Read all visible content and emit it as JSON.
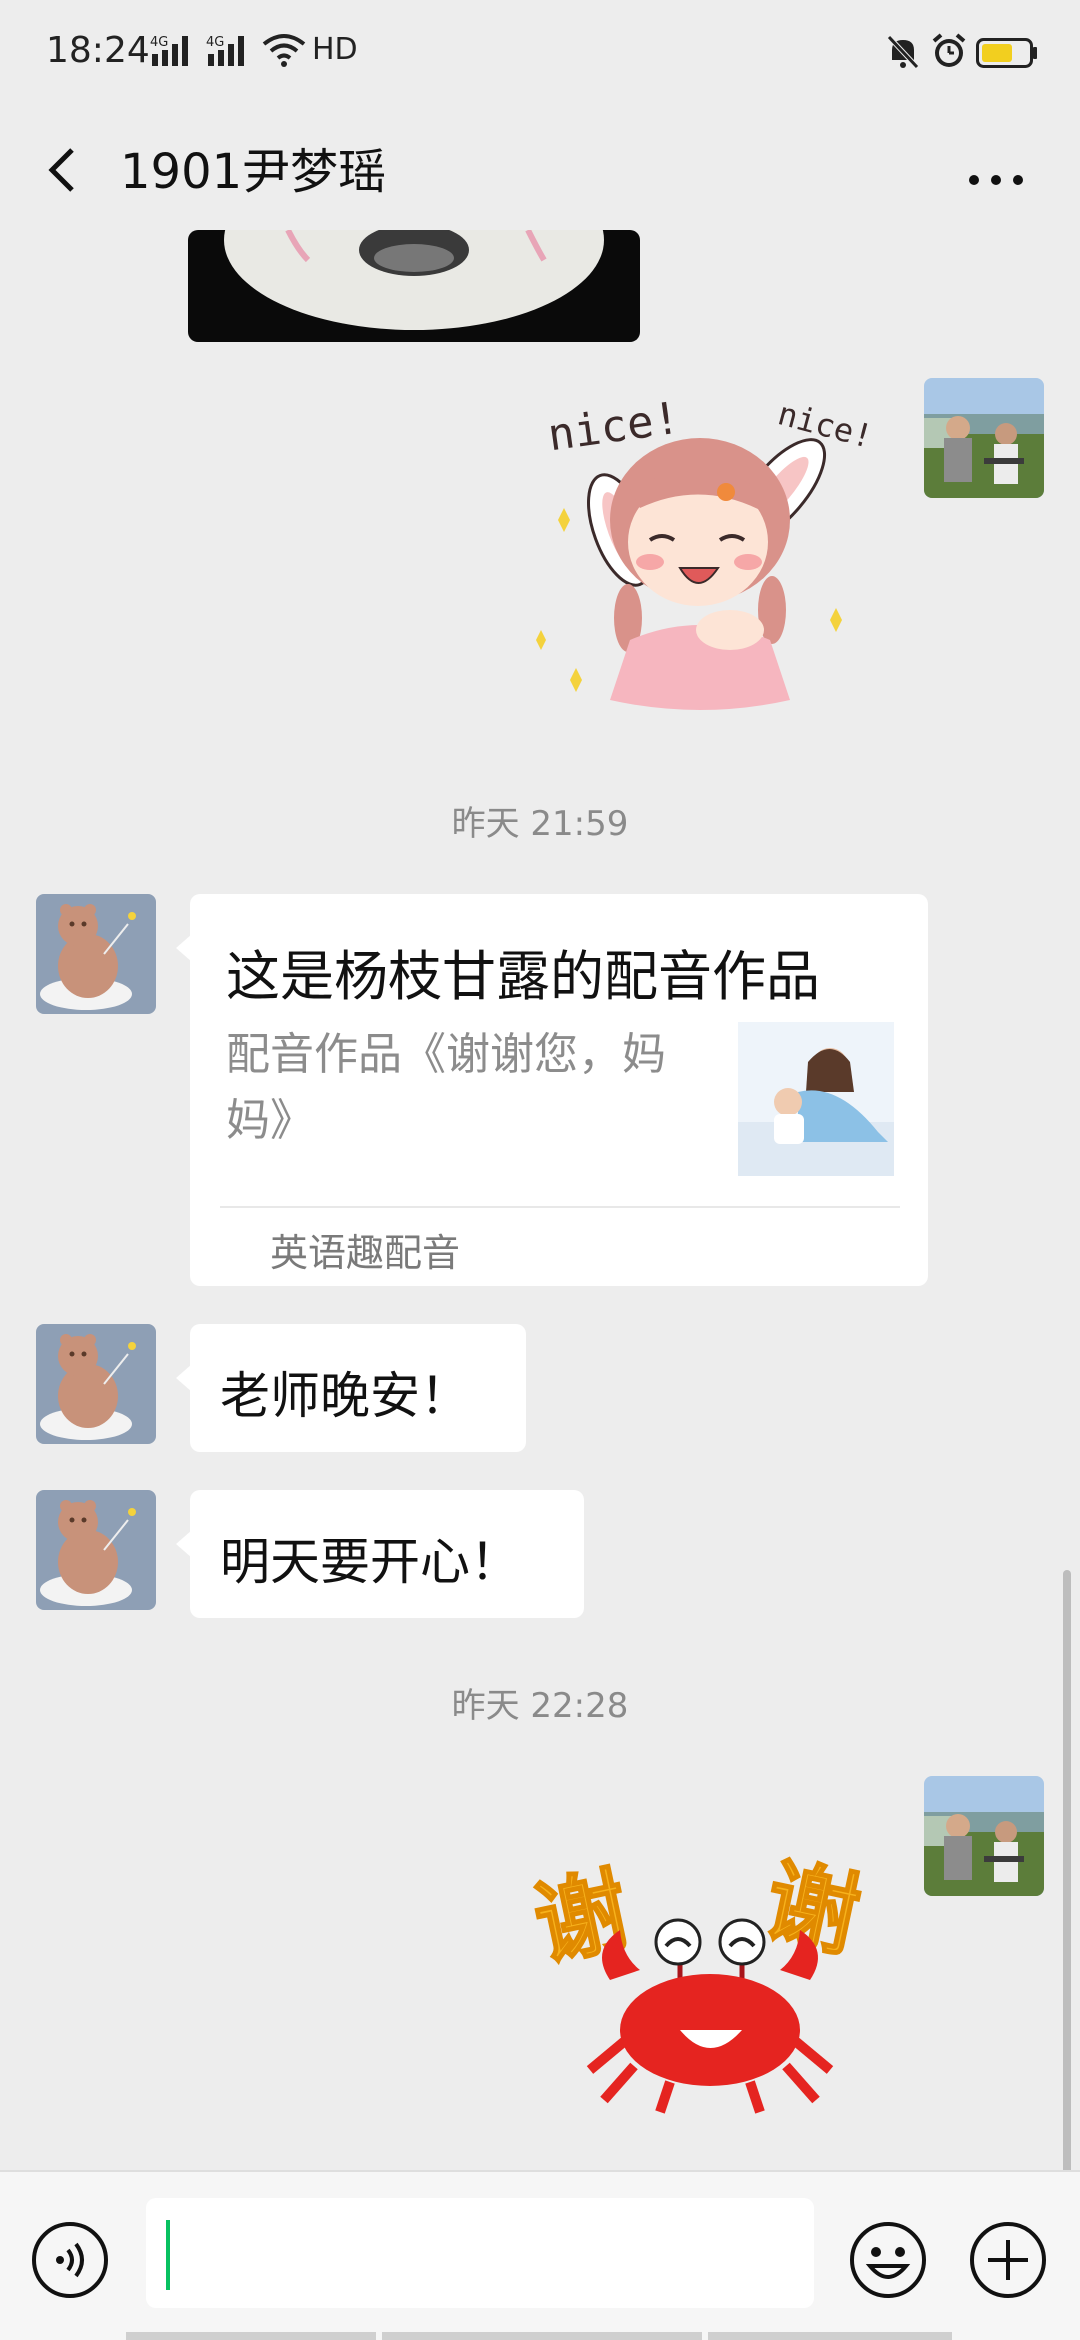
{
  "status_bar": {
    "time": "18:24",
    "hd": "HD",
    "icons": [
      "signal-4g-icon",
      "signal-4g-icon",
      "wifi-icon",
      "mute-bell-icon",
      "alarm-icon",
      "battery-icon"
    ],
    "battery_color": "#f2cf1f"
  },
  "title_bar": {
    "title": "1901尹梦瑶",
    "back_icon": "chevron-left-icon",
    "more_icon": "ellipsis-icon"
  },
  "messages": {
    "time_1": "昨天 21:59",
    "card": {
      "title": "这是杨枝甘露的配音作品",
      "description": "配音作品《谢谢您，妈妈》",
      "source": "英语趣配音"
    },
    "text_1": "老师晚安！",
    "text_2": "明天要开心！",
    "time_2": "昨天 22:28",
    "sticker_nice": {
      "word_left": "nice!",
      "word_right": "nice!"
    },
    "sticker_thanks": {
      "char_left": "谢",
      "char_right": "谢"
    }
  },
  "input_bar": {
    "voice_icon": "voice-icon",
    "emoji_icon": "emoji-icon",
    "plus_icon": "plus-circle-icon",
    "accent": "#07c160"
  }
}
